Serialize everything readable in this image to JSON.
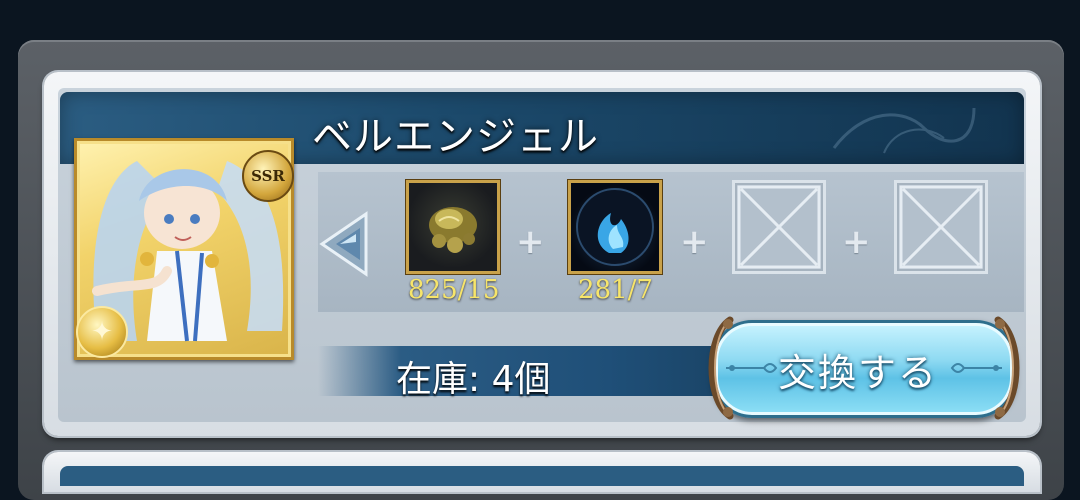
{
  "item": {
    "name": "ベルエンジェル",
    "rarity": "SSR",
    "element_icon": "light-element-icon"
  },
  "materials": [
    {
      "icon": "gold-ore-icon",
      "count": "825/15"
    },
    {
      "icon": "blue-flame-orb-icon",
      "count": "281/7"
    },
    {
      "icon": "empty-slot-icon",
      "count": ""
    },
    {
      "icon": "empty-slot-icon",
      "count": ""
    }
  ],
  "stock": {
    "label": "在庫: 4個"
  },
  "exchange": {
    "button_label": "交換する"
  },
  "colors": {
    "title_bar": "#1c4a6c",
    "count_text": "#f7e56a",
    "button_fill": "#8fdaf2"
  }
}
